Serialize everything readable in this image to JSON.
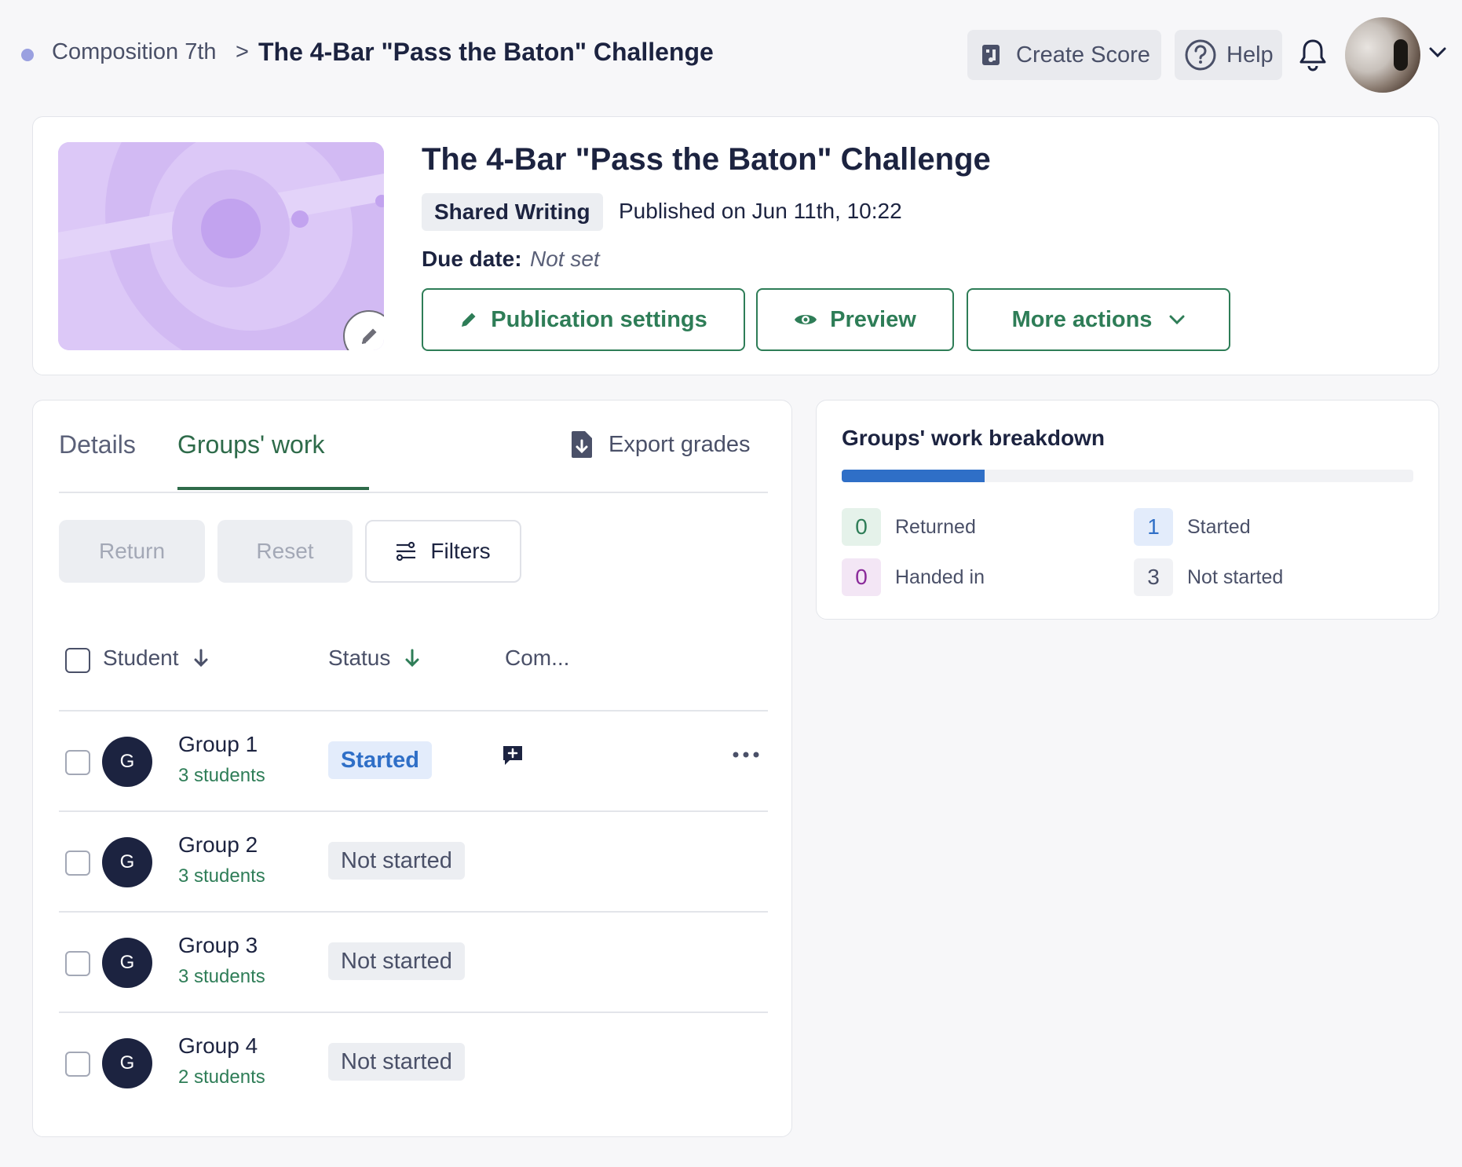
{
  "breadcrumb": {
    "parent": "Composition 7th",
    "separator": ">",
    "current": "The 4-Bar \"Pass the Baton\" Challenge"
  },
  "topbar": {
    "create_score_label": "Create Score",
    "help_label": "Help"
  },
  "assignment": {
    "title": "The 4-Bar \"Pass the Baton\" Challenge",
    "type_badge": "Shared Writing",
    "published": "Published on Jun 11th, 10:22",
    "due_label": "Due date:",
    "due_value": "Not set",
    "actions": {
      "publication_settings": "Publication settings",
      "preview": "Preview",
      "more_actions": "More actions"
    }
  },
  "tabs": {
    "details": "Details",
    "groups_work": "Groups' work",
    "export_grades": "Export grades"
  },
  "toolbar": {
    "return_label": "Return",
    "reset_label": "Reset",
    "filters_label": "Filters"
  },
  "table": {
    "columns": {
      "student": "Student",
      "status": "Status",
      "comments": "Com..."
    },
    "rows": [
      {
        "initial": "G",
        "name": "Group 1",
        "count": "3 students",
        "status": "Started"
      },
      {
        "initial": "G",
        "name": "Group 2",
        "count": "3 students",
        "status": "Not started"
      },
      {
        "initial": "G",
        "name": "Group 3",
        "count": "3 students",
        "status": "Not started"
      },
      {
        "initial": "G",
        "name": "Group 4",
        "count": "2 students",
        "status": "Not started"
      }
    ]
  },
  "breakdown": {
    "title": "Groups' work breakdown",
    "progress_fraction": 0.25,
    "stats": {
      "returned": {
        "value": "0",
        "label": "Returned"
      },
      "started": {
        "value": "1",
        "label": "Started"
      },
      "handed_in": {
        "value": "0",
        "label": "Handed in"
      },
      "not_started": {
        "value": "3",
        "label": "Not started"
      }
    }
  },
  "colors": {
    "accent_green": "#2e7d57",
    "started_blue": "#2f6fc7",
    "navy": "#1c2340",
    "cover_purple": "#dcc8f7"
  }
}
